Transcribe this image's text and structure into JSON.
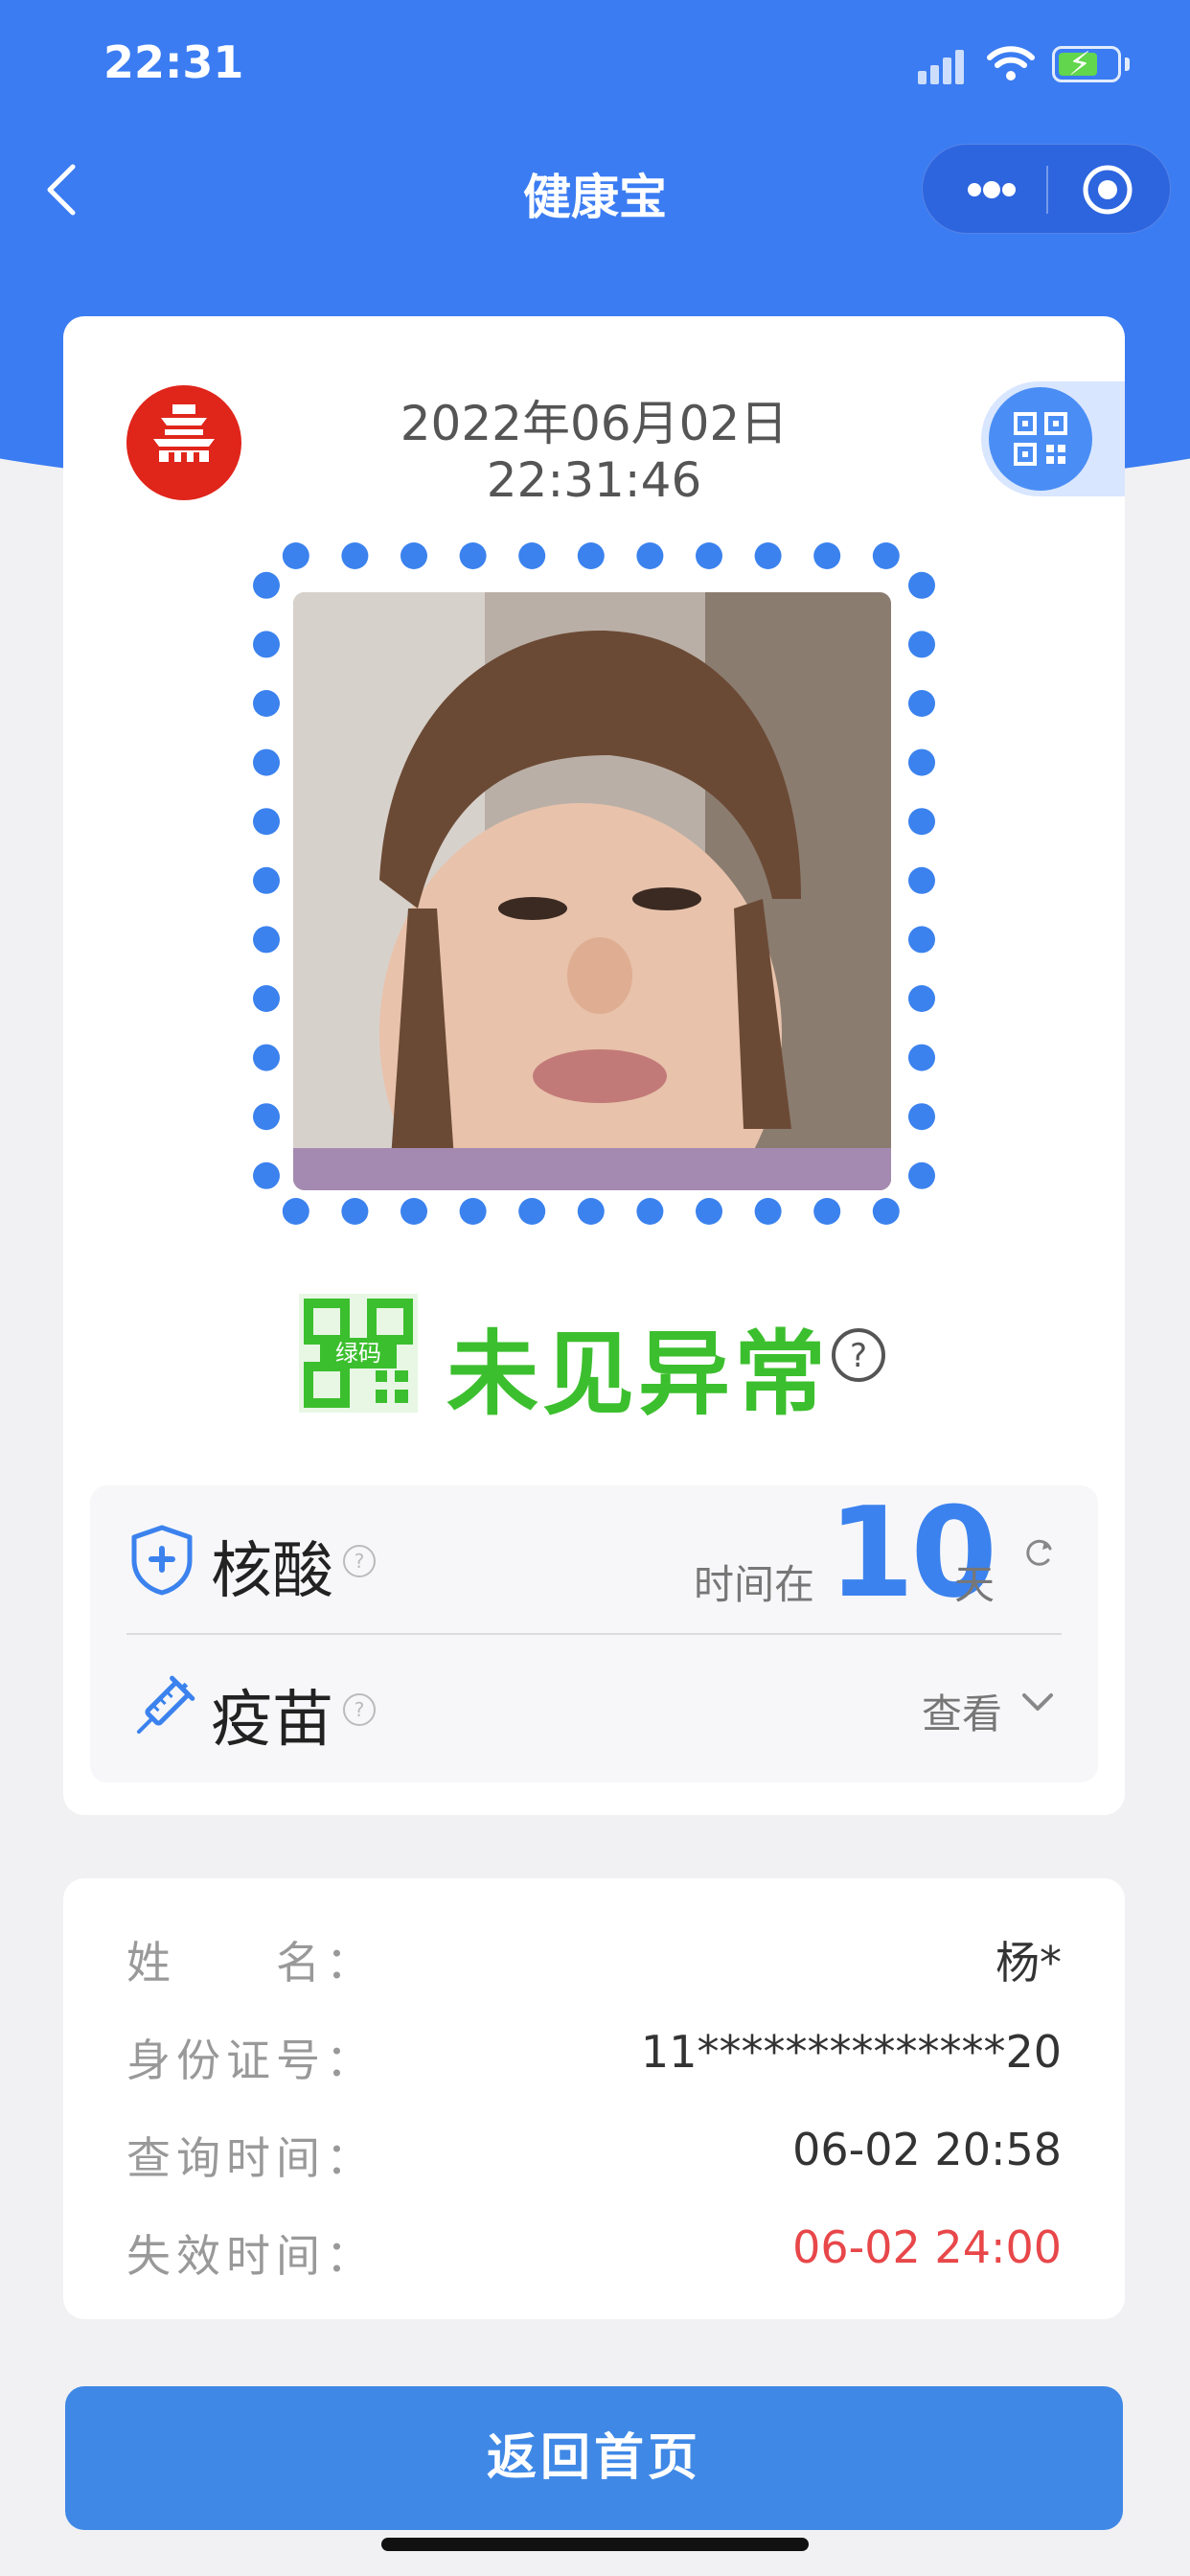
{
  "status_bar": {
    "time": "22:31"
  },
  "nav": {
    "title": "健康宝"
  },
  "main_card": {
    "logo_text": "北京健康宝",
    "date": "2022年06月02日",
    "time": "22:31:46",
    "qr_badge": "绿码",
    "status": "未见异常",
    "status_color": "#3cbf2e"
  },
  "tests": {
    "nucleic": {
      "label": "核酸",
      "prefix": "时间在",
      "days": "10",
      "suffix": "天"
    },
    "vaccine": {
      "label": "疫苗",
      "action": "查看"
    }
  },
  "info": [
    {
      "label": "姓　　名：",
      "value": "杨*"
    },
    {
      "label": "身份证号：",
      "value": "11**************20"
    },
    {
      "label": "查询时间：",
      "value": "06-02 20:58"
    },
    {
      "label": "失效时间：",
      "value": "06-02 24:00",
      "highlight": "#e8474a"
    }
  ],
  "home_button": "返回首页",
  "colors": {
    "primary": "#3b7cf2",
    "accent_blue": "#3b82ee",
    "green": "#3cbf2e",
    "red": "#e8474a"
  }
}
